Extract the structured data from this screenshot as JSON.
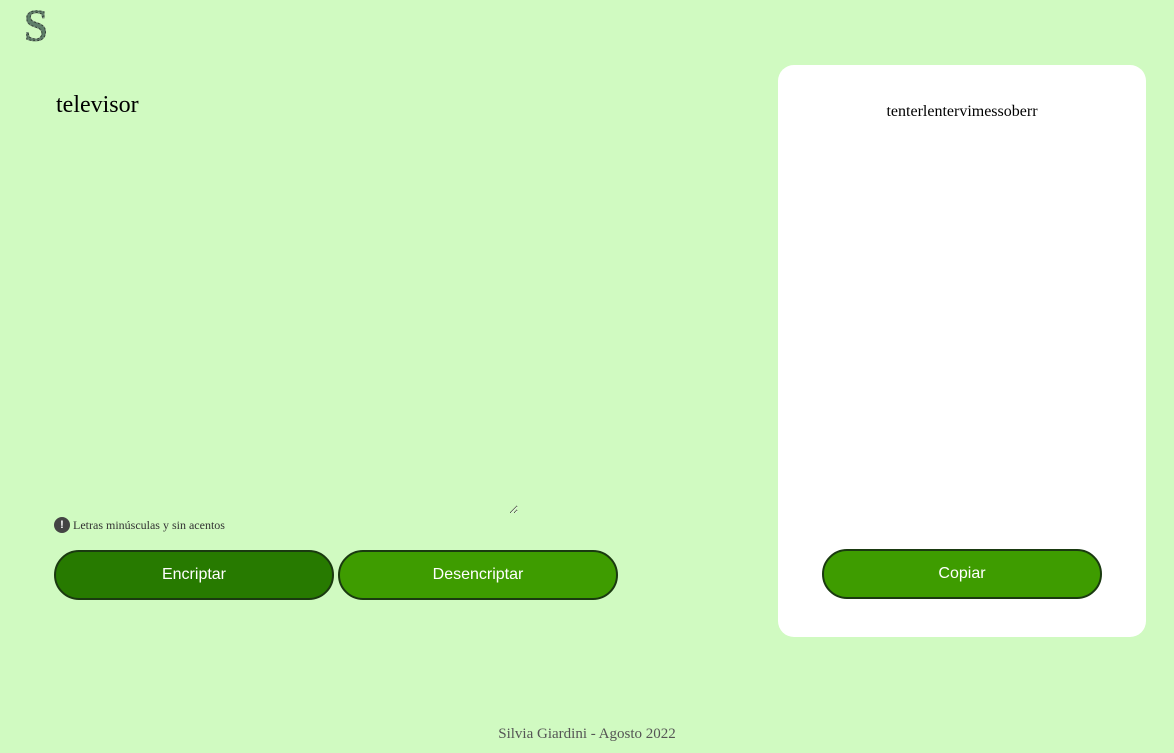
{
  "logo": {
    "letter": "S",
    "icon": "logo-s-icon"
  },
  "input": {
    "value": "televisor",
    "placeholder": ""
  },
  "hint": {
    "icon": "exclamation-icon",
    "text": "Letras minúsculas y sin acentos"
  },
  "buttons": {
    "encrypt_label": "Encriptar",
    "decrypt_label": "Desencriptar",
    "copy_label": "Copiar"
  },
  "output": {
    "text": "tenterlentervimessoberr"
  },
  "footer": {
    "text": "Silvia Giardini - Agosto 2022"
  },
  "colors": {
    "background": "#d0fac1",
    "encrypt_button": "#277a00",
    "secondary_button": "#3e9c00",
    "card": "#ffffff"
  }
}
